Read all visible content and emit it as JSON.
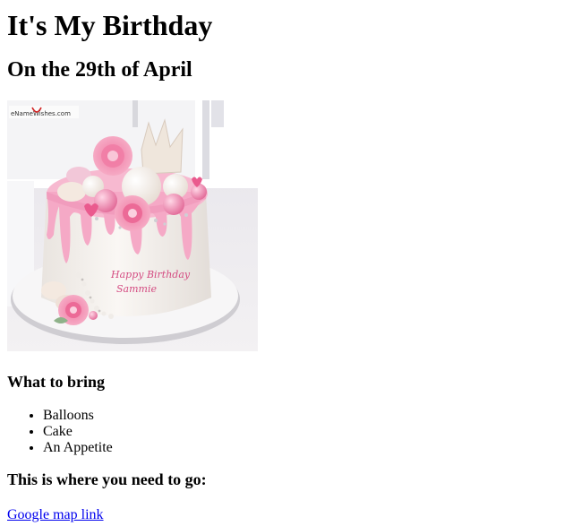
{
  "page": {
    "title": "It's My Birthday",
    "date_heading": "On the 29th of April",
    "image": {
      "watermark": "eNameWishes.com",
      "cake_text_line1": "Happy Birthday",
      "cake_text_line2": "Sammie"
    },
    "bring_heading": "What to bring",
    "bring_items": [
      "Balloons",
      "Cake",
      "An Appetite"
    ],
    "location_heading": "This is where you need to go:",
    "map_link_text": "Google map link"
  },
  "colors": {
    "link": "#0000ee",
    "frosting_pink": "#f2a9c4",
    "cake_white": "#f6f2ee",
    "rose": "#e8739c"
  }
}
